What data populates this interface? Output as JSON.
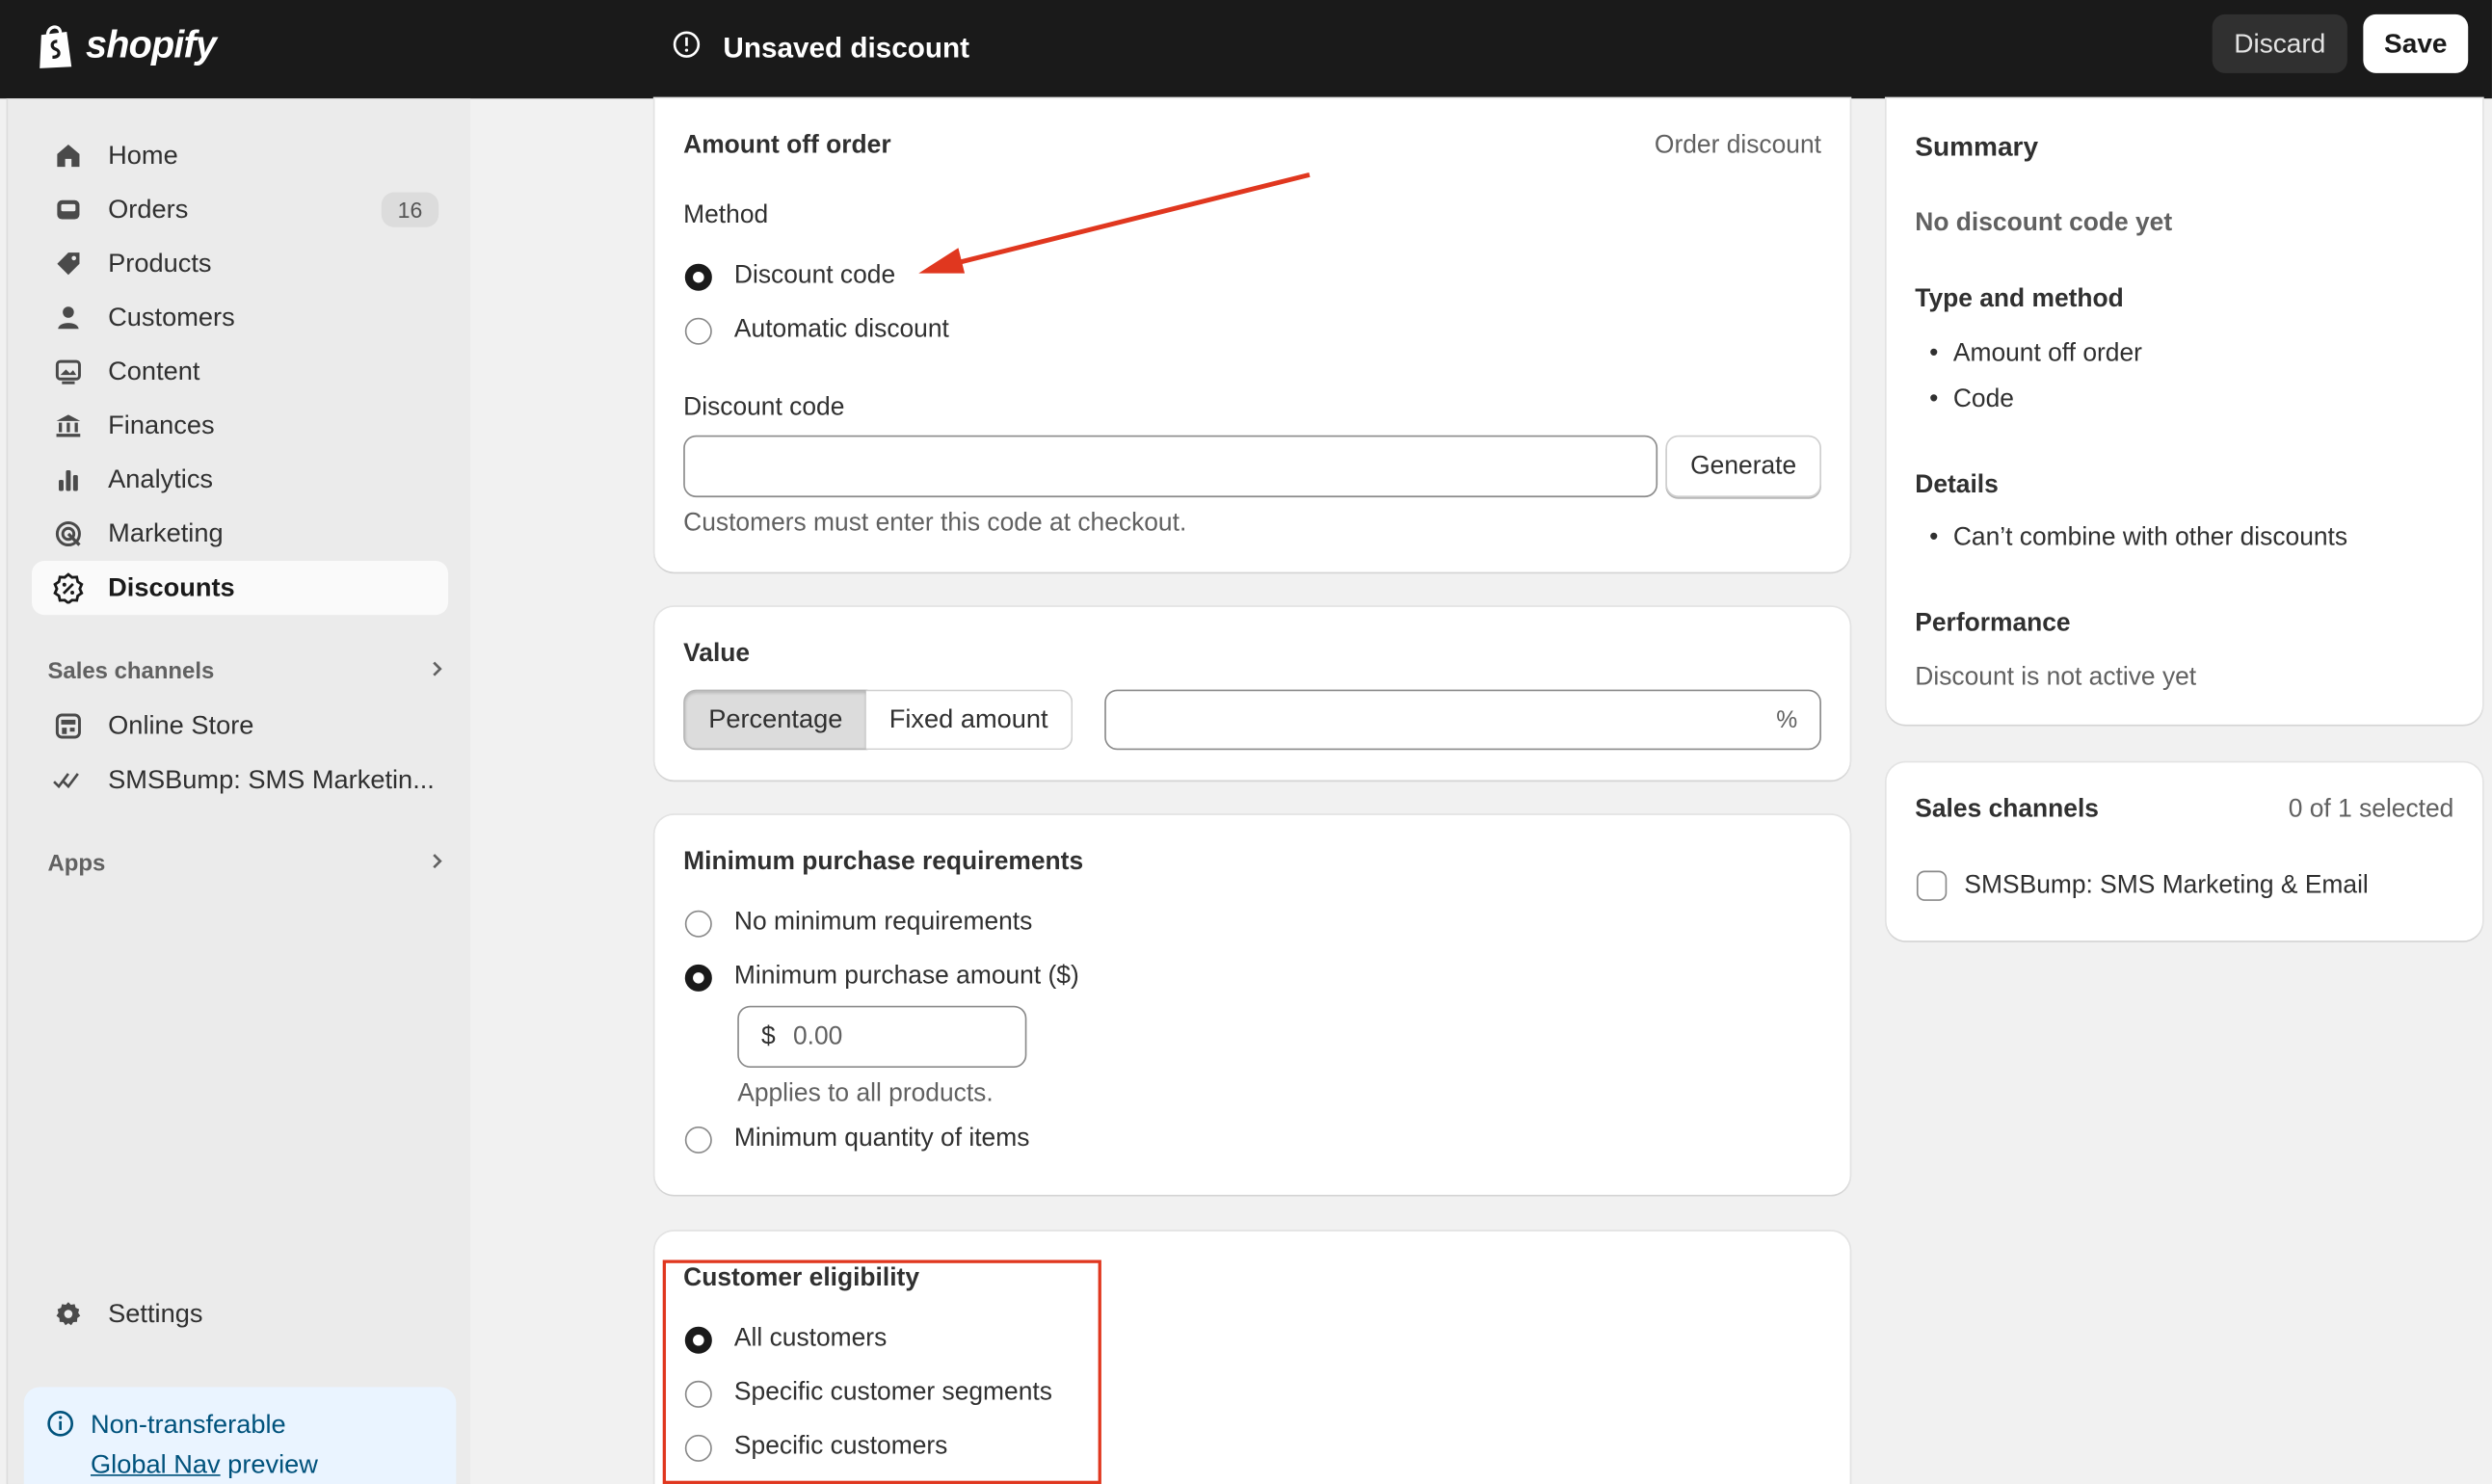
{
  "topbar": {
    "logo_text": "shopify",
    "status_title": "Unsaved discount",
    "discard_label": "Discard",
    "save_label": "Save"
  },
  "sidebar": {
    "items": [
      {
        "label": "Home",
        "icon": "home-icon"
      },
      {
        "label": "Orders",
        "icon": "orders-icon",
        "badge": "16"
      },
      {
        "label": "Products",
        "icon": "tag-icon"
      },
      {
        "label": "Customers",
        "icon": "person-icon"
      },
      {
        "label": "Content",
        "icon": "content-icon"
      },
      {
        "label": "Finances",
        "icon": "bank-icon"
      },
      {
        "label": "Analytics",
        "icon": "bar-chart-icon"
      },
      {
        "label": "Marketing",
        "icon": "target-icon"
      },
      {
        "label": "Discounts",
        "icon": "discount-icon",
        "active": true
      }
    ],
    "sales_channels_label": "Sales channels",
    "channels": [
      {
        "label": "Online Store",
        "icon": "store-icon"
      },
      {
        "label": "SMSBump: SMS Marketin...",
        "icon": "smsbump-icon"
      }
    ],
    "apps_label": "Apps",
    "settings_label": "Settings",
    "preview": {
      "line1": "Non-transferable",
      "link": "Global Nav",
      "line2_rest": " preview"
    }
  },
  "method_card": {
    "title": "Amount off order",
    "type_label": "Order discount",
    "method_label": "Method",
    "options": [
      "Discount code",
      "Automatic discount"
    ],
    "selected": "Discount code",
    "code_label": "Discount code",
    "code_value": "",
    "generate_label": "Generate",
    "help": "Customers must enter this code at checkout."
  },
  "value_card": {
    "title": "Value",
    "segments": [
      "Percentage",
      "Fixed amount"
    ],
    "selected": "Percentage",
    "value": "",
    "suffix": "%"
  },
  "minimum_card": {
    "title": "Minimum purchase requirements",
    "options": [
      "No minimum requirements",
      "Minimum purchase amount ($)",
      "Minimum quantity of items"
    ],
    "selected": "Minimum purchase amount ($)",
    "amount_prefix": "$",
    "amount_placeholder": "0.00",
    "help": "Applies to all products."
  },
  "eligibility_card": {
    "title": "Customer eligibility",
    "options": [
      "All customers",
      "Specific customer segments",
      "Specific customers"
    ],
    "selected": "All customers"
  },
  "summary": {
    "title": "Summary",
    "code_status": "No discount code yet",
    "type_heading": "Type and method",
    "type_items": [
      "Amount off order",
      "Code"
    ],
    "details_heading": "Details",
    "details_items": [
      "Can’t combine with other discounts"
    ],
    "performance_heading": "Performance",
    "performance_text": "Discount is not active yet"
  },
  "sales_channels_card": {
    "title": "Sales channels",
    "count": "0 of 1 selected",
    "channels": [
      {
        "label": "SMSBump: SMS Marketing & Email",
        "checked": false
      }
    ]
  },
  "annotation_colors": {
    "arrow": "#e0371f",
    "highlight_box": "#e0371f"
  }
}
